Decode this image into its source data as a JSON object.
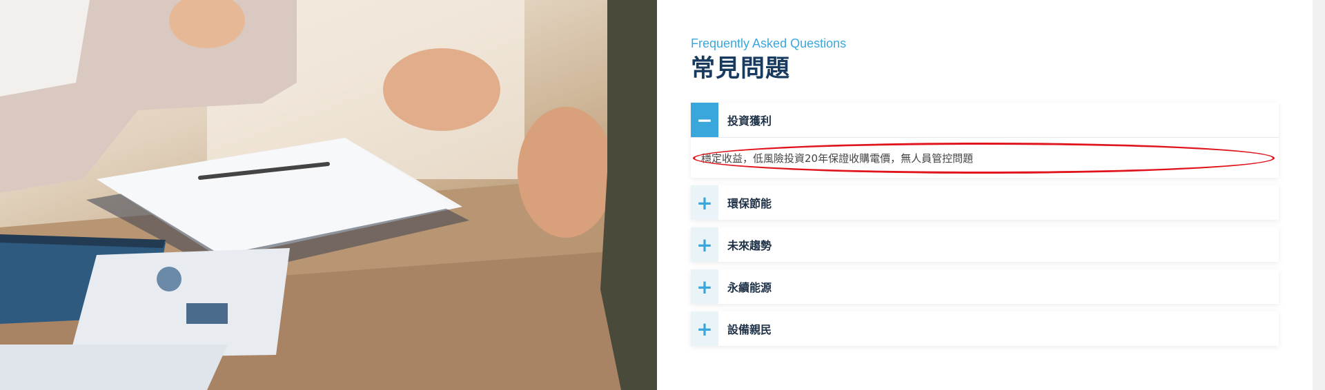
{
  "faq": {
    "eyebrow": "Frequently Asked Questions",
    "title": "常見問題",
    "items": [
      {
        "label": "投資獲利",
        "icon": "minus-icon",
        "expanded": true,
        "answer": "穩定收益，低風險投資20年保證收購電價，無人員管控問題"
      },
      {
        "label": "環保節能",
        "icon": "plus-icon",
        "expanded": false
      },
      {
        "label": "未來趨勢",
        "icon": "plus-icon",
        "expanded": false
      },
      {
        "label": "永續能源",
        "icon": "plus-icon",
        "expanded": false
      },
      {
        "label": "設備親民",
        "icon": "plus-icon",
        "expanded": false
      }
    ]
  },
  "colors": {
    "accent": "#3aa7dc",
    "title": "#173a5e",
    "highlight": "#e0141c"
  },
  "icons": {
    "expanded": "−",
    "collapsed": "+"
  }
}
